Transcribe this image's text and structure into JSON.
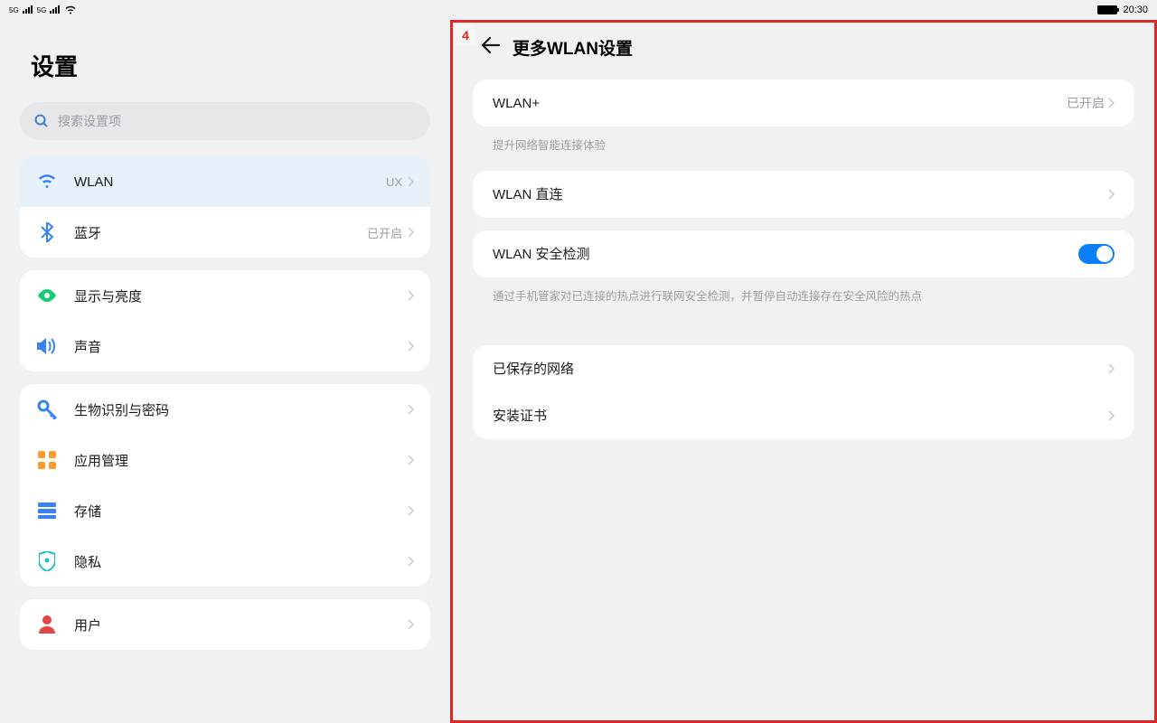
{
  "status": {
    "time": "20:30"
  },
  "left": {
    "title": "设置",
    "search_placeholder": "搜索设置项",
    "group1": {
      "wlan": {
        "label": "WLAN",
        "value": "UX"
      },
      "bt": {
        "label": "蓝牙",
        "value": "已开启"
      }
    },
    "group2": {
      "display": {
        "label": "显示与亮度"
      },
      "sound": {
        "label": "声音"
      }
    },
    "group3": {
      "biometric": {
        "label": "生物识别与密码"
      },
      "apps": {
        "label": "应用管理"
      },
      "storage": {
        "label": "存储"
      },
      "privacy": {
        "label": "隐私"
      }
    },
    "group4": {
      "user": {
        "label": "用户"
      }
    }
  },
  "right": {
    "annotation_number": "4",
    "title": "更多WLAN设置",
    "wlan_plus": {
      "label": "WLAN+",
      "value": "已开启"
    },
    "wlan_plus_desc": "提升网络智能连接体验",
    "wlan_direct": {
      "label": "WLAN 直连"
    },
    "wlan_security": {
      "label": "WLAN 安全检测"
    },
    "wlan_security_desc": "通过手机管家对已连接的热点进行联网安全检测，并暂停自动连接存在安全风险的热点",
    "saved_networks": {
      "label": "已保存的网络"
    },
    "install_cert": {
      "label": "安装证书"
    }
  }
}
